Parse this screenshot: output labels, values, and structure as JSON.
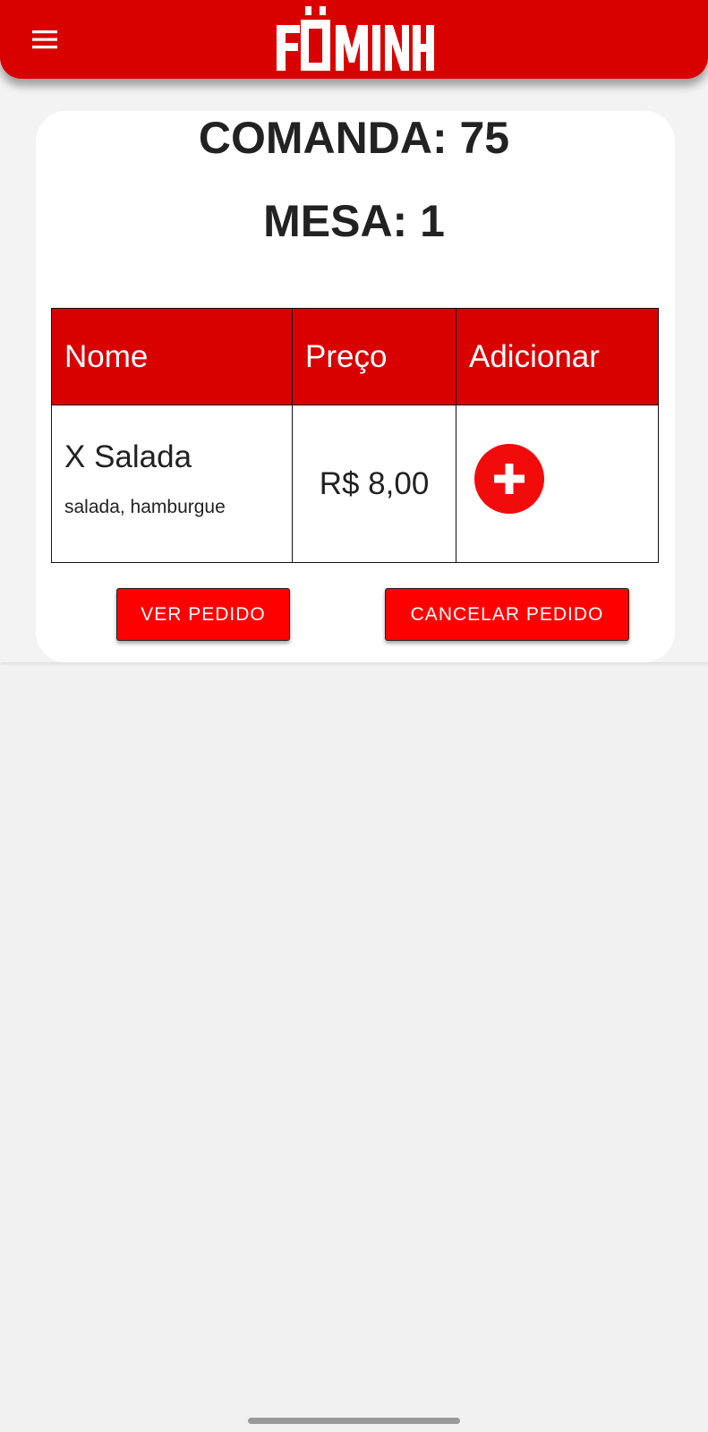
{
  "app_bar": {
    "logo_text": "FÖMINHA",
    "menu_icon": "hamburger-menu-icon",
    "brand_color": "#d90000"
  },
  "order": {
    "comanda": "COMANDA: 75",
    "mesa": "MESA: 1"
  },
  "table": {
    "headers": [
      "Nome",
      "Preço",
      "Adicionar"
    ],
    "rows": [
      {
        "name": "X Salada",
        "description": "salada, hamburgue",
        "price": "R$ 8,00",
        "add_icon": "plus-circle-icon"
      }
    ]
  },
  "actions": {
    "view_order": "VER PEDIDO",
    "cancel_order": "CANCELAR PEDIDO"
  }
}
